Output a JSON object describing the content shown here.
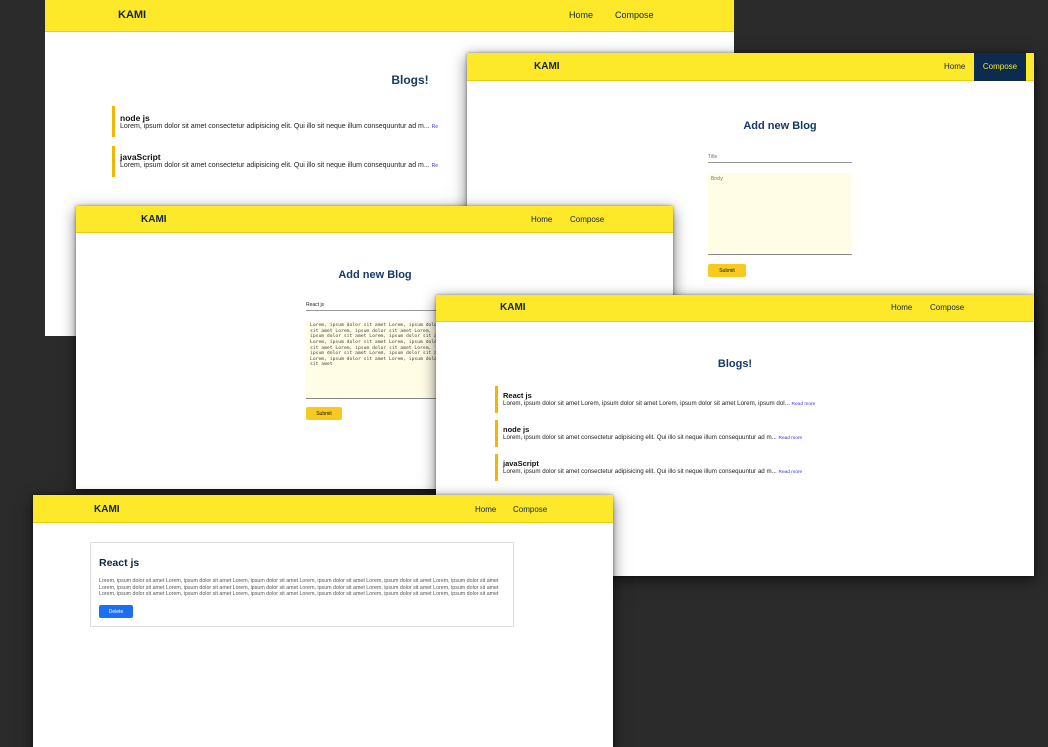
{
  "brand": "KAMI",
  "nav": {
    "home": "Home",
    "compose": "Compose"
  },
  "blogs_heading": "Blogs!",
  "compose_heading": "Add new Blog",
  "compose_form": {
    "title_placeholder": "Title",
    "body_placeholder": "Body",
    "submit_label": "Submit"
  },
  "filled_form": {
    "title_value": "React js",
    "body_value": "Lorem, ipsum dolor sit amet Lorem, ipsum dolor sit amet Lorem, ipsum dolor sit amet Lorem, ipsum dolor sit amet Lorem, ipsum dolor sit amet Lorem, ipsum dolor sit amet Lorem, ipsum dolor sit amet Lorem, ipsum dolor sit amet Lorem, ipsum dolor sit amet Lorem, ipsum dolor sit amet Lorem, ipsum dolor sit amet Lorem, ipsum dolor sit amet"
  },
  "read_more": "Read more",
  "read_more_cut": "Re",
  "posts_first": [
    {
      "title": "node js",
      "excerpt": "Lorem, ipsum dolor sit amet consectetur adipisicing elit. Qui illo sit neque illum consequuntur ad m..."
    },
    {
      "title": "javaScript",
      "excerpt": "Lorem, ipsum dolor sit amet consectetur adipisicing elit. Qui illo sit neque illum consequuntur ad m..."
    }
  ],
  "posts_second": [
    {
      "title": "React js",
      "excerpt": "Lorem, ipsum dolor sit amet Lorem, ipsum dolor sit amet Lorem, ipsum dolor sit amet Lorem, ipsum dol..."
    },
    {
      "title": "node js",
      "excerpt": "Lorem, ipsum dolor sit amet consectetur adipisicing elit. Qui illo sit neque illum consequuntur ad m..."
    },
    {
      "title": "javaScript",
      "excerpt": "Lorem, ipsum dolor sit amet consectetur adipisicing elit. Qui illo sit neque illum consequuntur ad m..."
    }
  ],
  "detail": {
    "title": "React js",
    "body_lines": [
      "Lorem, ipsum dolor sit amet Lorem, ipsum dolor sit amet Lorem, ipsum dolor sit amet Lorem, ipsum dolor sit amet Lorem, ipsum dolor sit amet Lorem, ipsum dolor sit amet",
      "Lorem, ipsum dolor sit amet Lorem, ipsum dolor sit amet Lorem, ipsum dolor sit amet Lorem, ipsum dolor sit amet Lorem, ipsum dolor sit amet Lorem, ipsum dolor sit amet",
      "Lorem, ipsum dolor sit amet Lorem, ipsum dolor sit amet Lorem, ipsum dolor sit amet Lorem, ipsum dolor sit amet Lorem, ipsum dolor sit amet Lorem, ipsum dolor sit amet"
    ],
    "delete_label": "Delete"
  },
  "colors": {
    "backdrop": "#2b2b2b",
    "navbar": "#fde82a",
    "navy": "#0f2545",
    "active_tab": "#0d2b4e",
    "accent_border": "#f2b705",
    "submit": "#f8c91e",
    "delete": "#1a6ff2",
    "textarea": "#fffde6",
    "link": "#3a34d6"
  }
}
